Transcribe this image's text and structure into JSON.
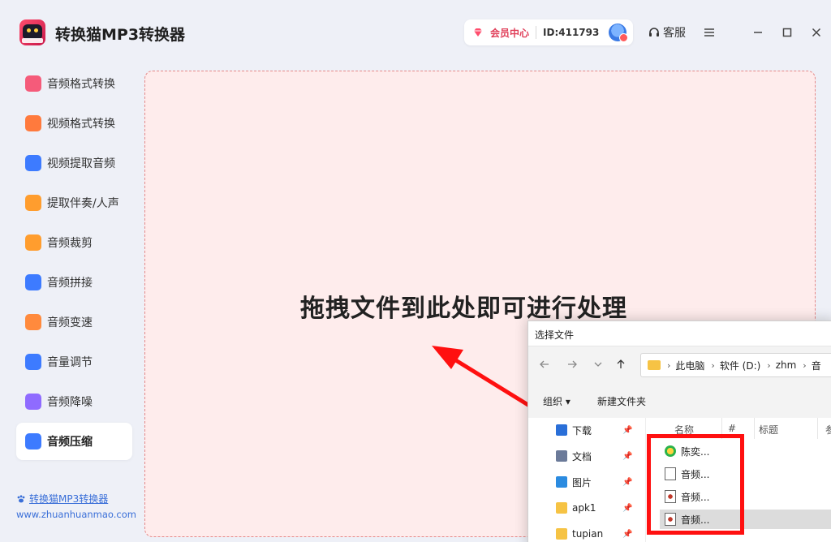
{
  "app": {
    "title": "转换猫MP3转换器",
    "vip_label": "会员中心",
    "user_id": "ID:411793",
    "service_label": "客服"
  },
  "sidebar": {
    "items": [
      {
        "label": "音频格式转换",
        "icon": "audio-format-icon",
        "color": "#f55b7a"
      },
      {
        "label": "视频格式转换",
        "icon": "video-format-icon",
        "color": "#ff7a3d"
      },
      {
        "label": "视频提取音频",
        "icon": "video-extract-audio-icon",
        "color": "#3d7bff"
      },
      {
        "label": "提取伴奏/人声",
        "icon": "vocal-extract-icon",
        "color": "#ff9d2e"
      },
      {
        "label": "音频裁剪",
        "icon": "audio-cut-icon",
        "color": "#ff9d2e"
      },
      {
        "label": "音频拼接",
        "icon": "audio-join-icon",
        "color": "#3d7bff"
      },
      {
        "label": "音频变速",
        "icon": "audio-speed-icon",
        "color": "#ff8a3d"
      },
      {
        "label": "音量调节",
        "icon": "volume-adjust-icon",
        "color": "#3d7bff"
      },
      {
        "label": "音频降噪",
        "icon": "noise-reduce-icon",
        "color": "#8f6bff"
      },
      {
        "label": "音频压缩",
        "icon": "audio-compress-icon",
        "color": "#3d7bff"
      }
    ],
    "active_index": 9
  },
  "footer": {
    "link_text": "转换猫MP3转换器",
    "url": "www.zhuanhuanmao.com"
  },
  "dropzone": {
    "text": "拖拽文件到此处即可进行处理"
  },
  "dialog": {
    "title": "选择文件",
    "breadcrumbs": [
      "此电脑",
      "软件 (D:)",
      "zhm",
      "音"
    ],
    "toolbar": {
      "organize": "组织",
      "new_folder": "新建文件夹"
    },
    "quick_access": [
      {
        "label": "下载",
        "icon": "download-icon"
      },
      {
        "label": "文档",
        "icon": "document-icon"
      },
      {
        "label": "图片",
        "icon": "image-icon"
      },
      {
        "label": "apk1",
        "icon": "folder-icon"
      },
      {
        "label": "tupian",
        "icon": "folder-icon"
      }
    ],
    "columns": [
      "名称",
      "#",
      "标题",
      "参"
    ],
    "files": [
      {
        "name": "陈奕...",
        "icon": "music-player-file-icon"
      },
      {
        "name": "音频...",
        "icon": "blank-file-icon"
      },
      {
        "name": "音频...",
        "icon": "audio-file-icon"
      },
      {
        "name": "音频...",
        "icon": "audio-file-icon",
        "selected": true
      }
    ]
  },
  "colors": {
    "accent": "#3a6fd8",
    "dropzone_bg": "#feecec",
    "highlight": "#ff1010"
  }
}
